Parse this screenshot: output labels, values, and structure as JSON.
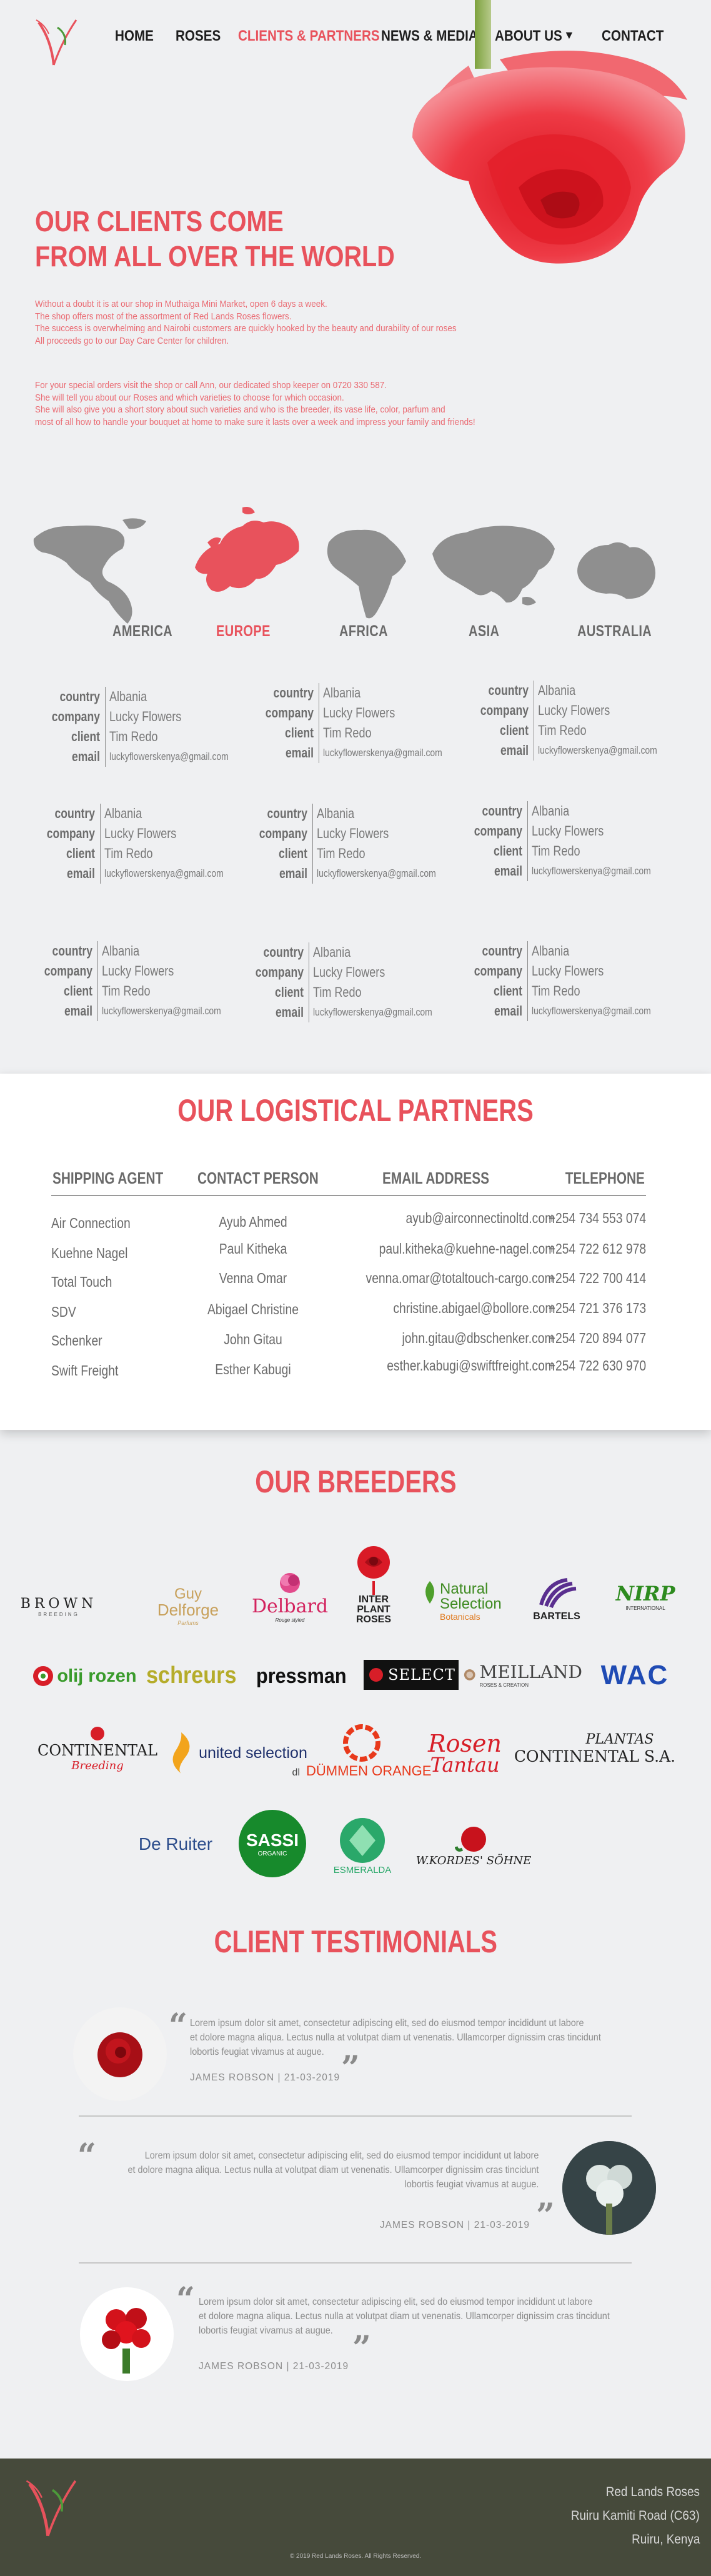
{
  "nav": {
    "home": "HOME",
    "roses": "ROSES",
    "clients": "CLIENTS & PARTNERS",
    "news": "NEWS & MEDIA",
    "about": "ABOUT US",
    "about_caret": "▼",
    "contact": "CONTACT"
  },
  "hero": {
    "title_line1": "OUR CLIENTS COME",
    "title_line2": "FROM ALL OVER THE WORLD",
    "p1": [
      "Without a doubt it is at our shop in Muthaiga Mini Market, open 6 days a week.",
      "The shop offers most of the assortment of Red Lands Roses flowers.",
      "The success is overwhelming and Nairobi customers are quickly hooked by the beauty and durability of our roses",
      "All proceeds go to our Day Care Center for children."
    ],
    "p2": [
      "For your special orders visit the shop or call Ann, our dedicated shop keeper on 0720 330 587.",
      "She will tell you about our Roses and which varieties to choose for which occasion.",
      "She will also give you a short story about such varieties and who is the breeder, its vase life, color, parfum and",
      "most of all how to handle your bouquet at home to make sure it lasts over a week and impress your family and friends!"
    ]
  },
  "regions": [
    {
      "label": "AMERICA",
      "active": false
    },
    {
      "label": "EUROPE",
      "active": true
    },
    {
      "label": "AFRICA",
      "active": false
    },
    {
      "label": "ASIA",
      "active": false
    },
    {
      "label": "AUSTRALIA",
      "active": false
    }
  ],
  "client_keys": {
    "country": "country",
    "company": "company",
    "client": "client",
    "email": "email"
  },
  "clients": [
    {
      "country": "Albania",
      "company": "Lucky Flowers",
      "client": "Tim Redo",
      "email": "luckyflowerskenya@gmail.com"
    },
    {
      "country": "Albania",
      "company": "Lucky Flowers",
      "client": "Tim Redo",
      "email": "luckyflowerskenya@gmail.com"
    },
    {
      "country": "Albania",
      "company": "Lucky Flowers",
      "client": "Tim Redo",
      "email": "luckyflowerskenya@gmail.com"
    },
    {
      "country": "Albania",
      "company": "Lucky Flowers",
      "client": "Tim Redo",
      "email": "luckyflowerskenya@gmail.com"
    },
    {
      "country": "Albania",
      "company": "Lucky Flowers",
      "client": "Tim Redo",
      "email": "luckyflowerskenya@gmail.com"
    },
    {
      "country": "Albania",
      "company": "Lucky Flowers",
      "client": "Tim Redo",
      "email": "luckyflowerskenya@gmail.com"
    },
    {
      "country": "Albania",
      "company": "Lucky Flowers",
      "client": "Tim Redo",
      "email": "luckyflowerskenya@gmail.com"
    },
    {
      "country": "Albania",
      "company": "Lucky Flowers",
      "client": "Tim Redo",
      "email": "luckyflowerskenya@gmail.com"
    },
    {
      "country": "Albania",
      "company": "Lucky Flowers",
      "client": "Tim Redo",
      "email": "luckyflowerskenya@gmail.com"
    }
  ],
  "logistics": {
    "title": "OUR LOGISTICAL PARTNERS",
    "headers": {
      "agent": "SHIPPING AGENT",
      "contact": "CONTACT PERSON",
      "email": "EMAIL ADDRESS",
      "phone": "TELEPHONE"
    },
    "rows": [
      {
        "agent": "Air Connection",
        "contact": "Ayub Ahmed",
        "email": "ayub@airconnectinoltd.com",
        "phone": "+254 734 553 074"
      },
      {
        "agent": "Kuehne Nagel",
        "contact": "Paul Kitheka",
        "email": "paul.kitheka@kuehne-nagel.com",
        "phone": "+254 722 612 978"
      },
      {
        "agent": "Total Touch",
        "contact": "Venna Omar",
        "email": "venna.omar@totaltouch-cargo.com",
        "phone": "+254 722 700 414"
      },
      {
        "agent": "SDV",
        "contact": "Abigael Christine",
        "email": "christine.abigael@bollore.com",
        "phone": "+254 721 376 173"
      },
      {
        "agent": "Schenker",
        "contact": "John Gitau",
        "email": "john.gitau@dbschenker.com",
        "phone": "+254 720 894 077"
      },
      {
        "agent": "Swift Freight",
        "contact": "Esther Kabugi",
        "email": "esther.kabugi@swiftfreight.com",
        "phone": "+254 722 630 970"
      }
    ]
  },
  "breeders": {
    "title": "OUR BREEDERS",
    "logos": {
      "brown": "BROWN",
      "brown_sub": "BREEDING",
      "guy": "Guy",
      "delforge": "Delforge",
      "guy_sub": "Parfums",
      "delbard": "Delbard",
      "delbard_sub": "Rouge styled",
      "interplant": "INTER PLANT ROSES",
      "natural": "Natural Selection",
      "natural_sub": "Botanicals",
      "bartels": "BARTELS",
      "nirp": "NIRP",
      "nirp_sub": "INTERNATIONAL",
      "olij": "olij rozen",
      "schreurs": "schreurs",
      "pressman": "pressman",
      "select": "SELECT",
      "meilland": "MEILLAND",
      "meilland_sub": "ROSES & CREATION",
      "wac": "WAC",
      "continental": "CONTINENTAL",
      "continental_sub": "Breeding",
      "united": "united selection",
      "dummen_pre": "dl",
      "dummen": "DÜMMEN ORANGE",
      "rosen": "Rosen",
      "tantau": "Tantau",
      "plantas": "PLANTAS",
      "plantas2": "CONTINENTAL S.A.",
      "deruiter": "De Ruiter",
      "sassi": "SASSI",
      "sassi_sub": "ORGANIC",
      "esmeralda": "ESMERALDA",
      "kordes": "W.KORDES' SÖHNE"
    }
  },
  "testimonials": {
    "title": "CLIENT TESTIMONIALS",
    "items": [
      {
        "text": [
          "Lorem ipsum dolor sit amet, consectetur adipiscing elit, sed do eiusmod tempor incididunt ut labore",
          "et dolore magna aliqua. Lectus nulla at volutpat diam ut venenatis. Ullamcorper dignissim cras tincidunt",
          "lobortis feugiat vivamus at augue."
        ],
        "name": "JAMES  ROBSON  |  21-03-2019"
      },
      {
        "text": [
          "Lorem ipsum dolor sit amet, consectetur adipiscing elit, sed do eiusmod tempor incididunt ut labore",
          "et dolore magna aliqua. Lectus nulla at volutpat diam ut venenatis. Ullamcorper dignissim cras tincidunt",
          "lobortis feugiat vivamus at augue."
        ],
        "name": "JAMES  ROBSON  |  21-03-2019"
      },
      {
        "text": [
          "Lorem ipsum dolor sit amet, consectetur adipiscing elit, sed do eiusmod tempor incididunt ut labore",
          "et dolore magna aliqua. Lectus nulla at volutpat diam ut venenatis. Ullamcorper dignissim cras tincidunt",
          "lobortis feugiat vivamus at augue."
        ],
        "name": "JAMES  ROBSON  |  21-03-2019"
      }
    ],
    "open_quote": "“",
    "close_quote": "”"
  },
  "footer": {
    "line1": "Red Lands Roses",
    "line2": "Ruiru Kamiti Road (C63)",
    "line3": "Ruiru, Kenya",
    "copyright": "© 2019 Red Lands Roses. All Rights Reserved."
  },
  "colors": {
    "accent": "#e8525c",
    "text": "#6a6a6a",
    "footer": "#464a3b"
  }
}
